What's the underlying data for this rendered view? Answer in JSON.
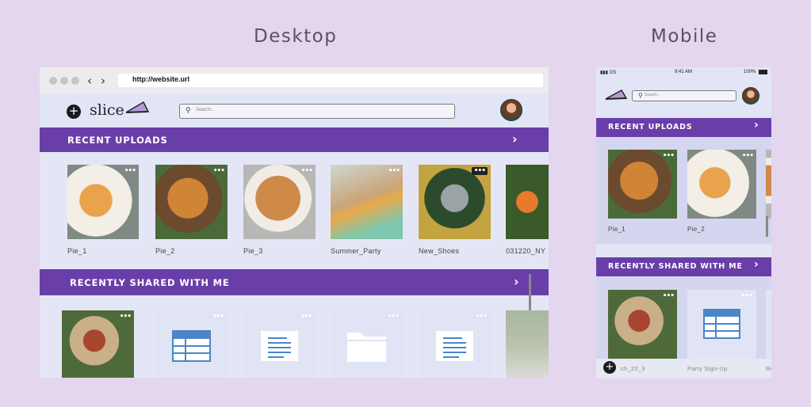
{
  "labels": {
    "desktop": "Desktop",
    "mobile": "Mobile"
  },
  "browser": {
    "url": "http://website.url"
  },
  "app": {
    "logo": "slice",
    "search_placeholder": "Search...",
    "accent": "#6a3ea8"
  },
  "sections": {
    "recent_uploads": "RECENT UPLOADS",
    "shared_with_me": "RECENTLY SHARED WITH ME"
  },
  "recent_uploads": [
    {
      "name": "Pie_1"
    },
    {
      "name": "Pie_2"
    },
    {
      "name": "Pie_3"
    },
    {
      "name": "Summer_Party"
    },
    {
      "name": "New_Shoes"
    },
    {
      "name": "031220_NY"
    }
  ],
  "shared": [
    {
      "kind": "photo"
    },
    {
      "kind": "spreadsheet"
    },
    {
      "kind": "document"
    },
    {
      "kind": "folder"
    },
    {
      "kind": "document"
    },
    {
      "kind": "photo"
    }
  ],
  "mobile": {
    "status": {
      "carrier": "GS",
      "time": "9:41 AM",
      "battery": "100%"
    },
    "uploads": [
      {
        "name": "Pie_1"
      },
      {
        "name": "Pie_2"
      }
    ],
    "shared": [
      {
        "name": "ch_22_3"
      },
      {
        "name": "Party Sign-Up"
      },
      {
        "name": "Re"
      }
    ]
  },
  "icons": {
    "more": "•••",
    "chevron": "›",
    "add": "+",
    "back": "‹",
    "forward": "›",
    "search": "🔍"
  }
}
